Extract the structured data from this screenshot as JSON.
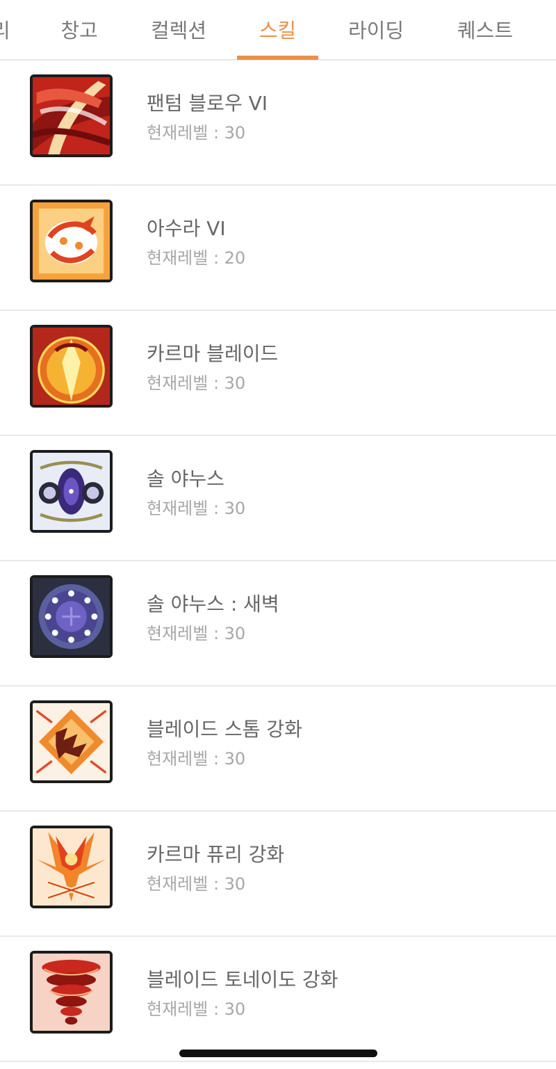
{
  "tabs": [
    {
      "label": "리",
      "active": false
    },
    {
      "label": "창고",
      "active": false
    },
    {
      "label": "컬렉션",
      "active": false
    },
    {
      "label": "스킬",
      "active": true
    },
    {
      "label": "라이딩",
      "active": false
    },
    {
      "label": "퀘스트",
      "active": false
    }
  ],
  "accent_color": "#ec8f4a",
  "skills": [
    {
      "name": "팬텀 블로우 VI",
      "level": "현재레벨 : 30",
      "icon": "red-slash-icon"
    },
    {
      "name": "아수라 VI",
      "level": "현재레벨 : 20",
      "icon": "orange-whirlwind-icon"
    },
    {
      "name": "카르마 블레이드",
      "level": "현재레벨 : 30",
      "icon": "golden-aura-icon"
    },
    {
      "name": "솔 야누스",
      "level": "현재레벨 : 30",
      "icon": "twin-portal-icon"
    },
    {
      "name": "솔 야누스 : 새벽",
      "level": "현재레벨 : 30",
      "icon": "dark-portal-icon"
    },
    {
      "name": "블레이드 스톰 강화",
      "level": "현재레벨 : 30",
      "icon": "blade-storm-icon"
    },
    {
      "name": "카르마 퓨리 강화",
      "level": "현재레벨 : 30",
      "icon": "karma-fury-icon"
    },
    {
      "name": "블레이드 토네이도 강화",
      "level": "현재레벨 : 30",
      "icon": "red-tornado-icon"
    }
  ]
}
